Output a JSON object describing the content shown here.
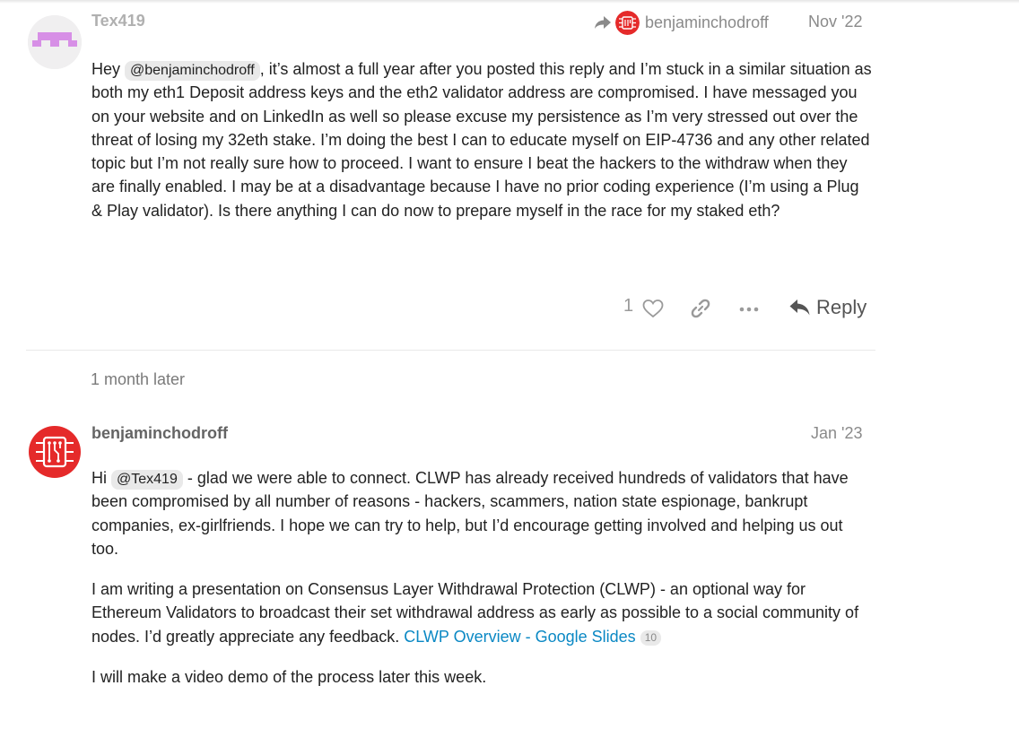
{
  "posts": [
    {
      "username": "Tex419",
      "date": "Nov '22",
      "reply_to": "benjaminchodroff",
      "avatar_icon": "pixel-identicon",
      "avatar_color": "#d78fe6",
      "body_parts": {
        "prefix": "Hey ",
        "mention": "@benjaminchodroff",
        "suffix": ", it’s almost a full year after you posted this reply and I’m stuck in a similar situation as both my eth1 Deposit address keys and the eth2 validator address are compromised. I have messaged you on your website and on LinkedIn as well so please excuse my persistence as I’m very stressed out over the threat of losing my 32eth stake. I’m doing the best I can to educate myself on EIP-4736 and any other related topic but I’m not really sure how to proceed. I want to ensure I beat the hackers to the withdraw when they are finally enabled. I may be at a disadvantage because I have no prior coding experience (I’m using a Plug & Play validator). Is there anything I can do now to prepare myself in the race for my staked eth?"
      },
      "actions": {
        "like_count": "1",
        "reply_label": "Reply",
        "icons": [
          "heart-icon",
          "link-icon",
          "more-icon",
          "reply-icon"
        ]
      }
    },
    {
      "username": "benjaminchodroff",
      "date": "Jan '23",
      "avatar_icon": "circuit-chip-logo",
      "avatar_color": "#e52a2a",
      "paragraphs": {
        "p1_prefix": "Hi ",
        "p1_mention": "@Tex419",
        "p1_suffix": " - glad we were able to connect. CLWP has already received hundreds of validators that have been compromised by all number of reasons - hackers, scammers, nation state espionage, bankrupt companies, ex-girlfriends. I hope we can try to help, but I’d encourage getting involved and helping us out too.",
        "p2_text": "I am writing a presentation on Consensus Layer Withdrawal Protection (CLWP) - an optional way for Ethereum Validators to broadcast their set withdrawal address as early as possible to a social community of nodes. I’d greatly appreciate any feedback. ",
        "p2_link": "CLWP Overview - Google Slides",
        "p2_link_clicks": "10",
        "p3_text": "I will make a video demo of the process later this week."
      }
    }
  ],
  "time_gap": "1 month later",
  "colors": {
    "link": "#0a88c4",
    "mention_bg": "#e9e9e9",
    "muted_text": "#8a8a8a"
  }
}
